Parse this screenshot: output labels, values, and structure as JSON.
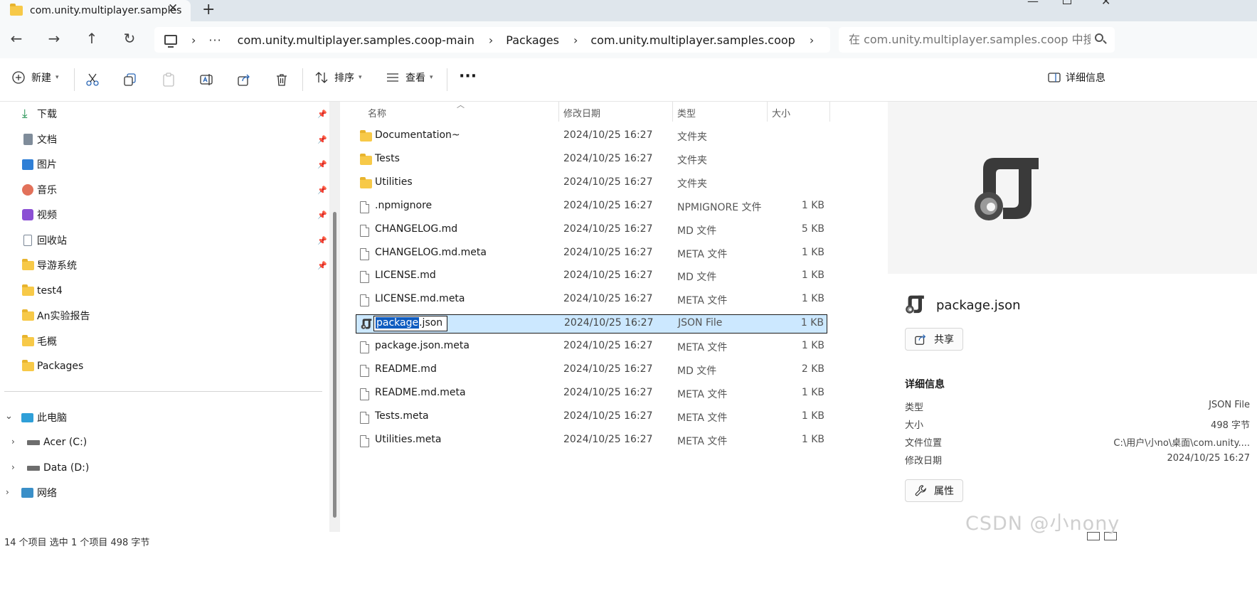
{
  "window": {
    "tab_title": "com.unity.multiplayer.samples",
    "tab_close": "✕",
    "new_tab": "+"
  },
  "nav": {
    "back": "←",
    "forward": "→",
    "up": "↑",
    "refresh": "↻",
    "more": "···",
    "breadcrumbs": [
      "com.unity.multiplayer.samples.coop-main",
      "Packages",
      "com.unity.multiplayer.samples.coop"
    ],
    "search_placeholder": "在 com.unity.multiplayer.samples.coop 中搜索"
  },
  "toolbar": {
    "new_label": "新建",
    "sort_label": "排序",
    "view_label": "查看",
    "more_label": "···",
    "details_label": "详细信息"
  },
  "sidebar": {
    "quick_access": [
      {
        "label": "下载",
        "icon": "download-icon"
      },
      {
        "label": "文档",
        "icon": "documents-icon"
      },
      {
        "label": "图片",
        "icon": "pictures-icon"
      },
      {
        "label": "音乐",
        "icon": "music-icon"
      },
      {
        "label": "视频",
        "icon": "videos-icon"
      },
      {
        "label": "回收站",
        "icon": "recycle-bin-icon"
      },
      {
        "label": "导游系统",
        "icon": "folder-icon"
      }
    ],
    "folders": [
      "test4",
      "An实验报告",
      "毛概",
      "Packages"
    ],
    "this_pc": "此电脑",
    "drives": [
      "Acer (C:)",
      "Data (D:)"
    ],
    "network": "网络"
  },
  "columns": {
    "name": "名称",
    "date": "修改日期",
    "type": "类型",
    "size": "大小"
  },
  "files": [
    {
      "name": "Documentation~",
      "date": "2024/10/25 16:27",
      "type": "文件夹",
      "size": "",
      "kind": "folder"
    },
    {
      "name": "Tests",
      "date": "2024/10/25 16:27",
      "type": "文件夹",
      "size": "",
      "kind": "folder"
    },
    {
      "name": "Utilities",
      "date": "2024/10/25 16:27",
      "type": "文件夹",
      "size": "",
      "kind": "folder"
    },
    {
      "name": ".npmignore",
      "date": "2024/10/25 16:27",
      "type": "NPMIGNORE 文件",
      "size": "1 KB",
      "kind": "file"
    },
    {
      "name": "CHANGELOG.md",
      "date": "2024/10/25 16:27",
      "type": "MD 文件",
      "size": "5 KB",
      "kind": "file"
    },
    {
      "name": "CHANGELOG.md.meta",
      "date": "2024/10/25 16:27",
      "type": "META 文件",
      "size": "1 KB",
      "kind": "file"
    },
    {
      "name": "LICENSE.md",
      "date": "2024/10/25 16:27",
      "type": "MD 文件",
      "size": "1 KB",
      "kind": "file"
    },
    {
      "name": "LICENSE.md.meta",
      "date": "2024/10/25 16:27",
      "type": "META 文件",
      "size": "1 KB",
      "kind": "file"
    },
    {
      "name": "package.json",
      "date": "2024/10/25 16:27",
      "type": "JSON File",
      "size": "1 KB",
      "kind": "json",
      "selected": true
    },
    {
      "name": "package.json.meta",
      "date": "2024/10/25 16:27",
      "type": "META 文件",
      "size": "1 KB",
      "kind": "file"
    },
    {
      "name": "README.md",
      "date": "2024/10/25 16:27",
      "type": "MD 文件",
      "size": "2 KB",
      "kind": "file"
    },
    {
      "name": "README.md.meta",
      "date": "2024/10/25 16:27",
      "type": "META 文件",
      "size": "1 KB",
      "kind": "file"
    },
    {
      "name": "Tests.meta",
      "date": "2024/10/25 16:27",
      "type": "META 文件",
      "size": "1 KB",
      "kind": "file"
    },
    {
      "name": "Utilities.meta",
      "date": "2024/10/25 16:27",
      "type": "META 文件",
      "size": "1 KB",
      "kind": "file"
    }
  ],
  "rename": {
    "selected_part": "package",
    "rest": ".json"
  },
  "details": {
    "file_name": "package.json",
    "share_label": "共享",
    "section_title": "详细信息",
    "props": [
      {
        "label": "类型",
        "value": "JSON File"
      },
      {
        "label": "大小",
        "value": "498 字节"
      },
      {
        "label": "文件位置",
        "value": "C:\\用户\\小no\\桌面\\com.unity...."
      },
      {
        "label": "修改日期",
        "value": "2024/10/25 16:27"
      }
    ],
    "properties_label": "属性"
  },
  "status": {
    "text": "14 个项目    选中 1 个项目  498 字节"
  },
  "watermark": "CSDN @小nony",
  "colors": {
    "accent": "#0f5cc0",
    "selection": "#cce8ff",
    "folder": "#f7c948"
  }
}
